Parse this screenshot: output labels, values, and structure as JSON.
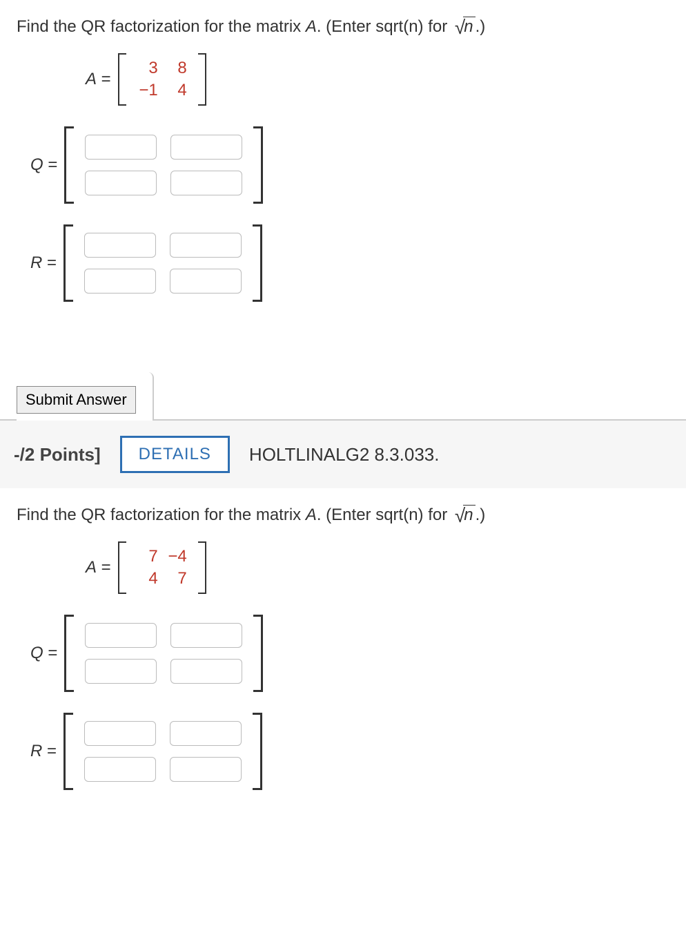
{
  "problems": [
    {
      "prompt_main": "Find the QR factorization for the matrix ",
      "prompt_var": "A",
      "prompt_tail": ". (Enter sqrt(n) for ",
      "sqrt_var": "n",
      "prompt_close": ".)",
      "A_label": "A",
      "A": [
        [
          "3",
          "8"
        ],
        [
          "−1",
          "4"
        ]
      ],
      "Q_label": "Q",
      "R_label": "R",
      "eq": " ="
    },
    {
      "prompt_main": "Find the QR factorization for the matrix ",
      "prompt_var": "A",
      "prompt_tail": ". (Enter sqrt(n) for ",
      "sqrt_var": "n",
      "prompt_close": ".)",
      "A_label": "A",
      "A": [
        [
          "7",
          "−4"
        ],
        [
          "4",
          "7"
        ]
      ],
      "Q_label": "Q",
      "R_label": "R",
      "eq": " ="
    }
  ],
  "submit_label": "Submit Answer",
  "header": {
    "points": "-/2 Points]",
    "details": "DETAILS",
    "source": "HOLTLINALG2 8.3.033."
  }
}
